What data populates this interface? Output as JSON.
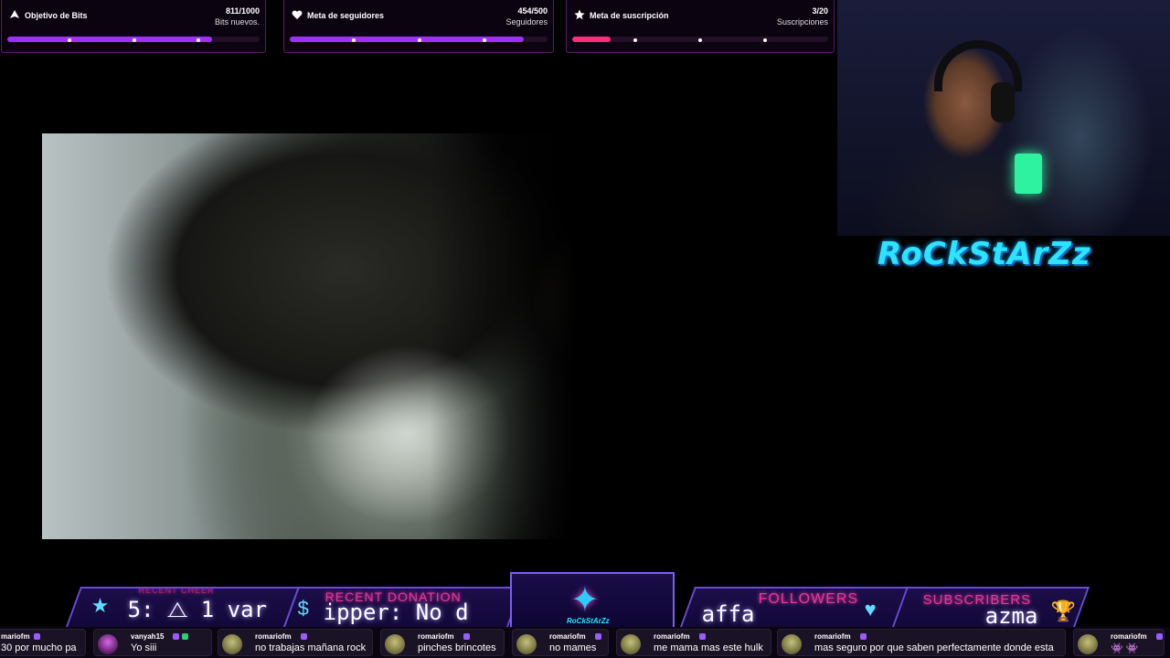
{
  "goals": [
    {
      "id": "bits",
      "icon": "bits-icon",
      "title": "Objetivo de Bits",
      "count": "811/1000",
      "subtitle": "Bits nuevos.",
      "progress": 0.811,
      "color": "#9b30ff"
    },
    {
      "id": "followers",
      "icon": "heart-icon",
      "title": "Meta de seguidores",
      "count": "454/500",
      "subtitle": "Seguidores",
      "progress": 0.908,
      "color": "#9b30ff"
    },
    {
      "id": "subs",
      "icon": "star-icon",
      "title": "Meta de suscripción",
      "count": "3/20",
      "subtitle": "Suscripciones",
      "progress": 0.15,
      "color": "#ff2d7a"
    }
  ],
  "streamer": {
    "name_logo": "RoCkStArZz"
  },
  "alerts": {
    "recent_cheer": {
      "label": "RECENT CHEER",
      "value": "5: ⧍ 1  var"
    },
    "recent_donation": {
      "label": "RECENT DONATION",
      "value": "ipper: No d"
    },
    "center_badge": {
      "text": "RoCkStArZz"
    },
    "followers": {
      "label": "FOLLOWERS",
      "value": "affa"
    },
    "subscribers": {
      "label": "SUBSCRIBERS",
      "value": "azma"
    }
  },
  "chat": [
    {
      "user": "mariofm",
      "text": "30 por mucho pa",
      "avatar": "default"
    },
    {
      "user": "vanyah15",
      "text": "Yo siii",
      "avatar": "violet"
    },
    {
      "user": "romariofm",
      "text": "no trabajas mañana rock",
      "avatar": "default"
    },
    {
      "user": "romariofm",
      "text": "pinches brincotes",
      "avatar": "default"
    },
    {
      "user": "romariofm",
      "text": "no mames",
      "avatar": "default"
    },
    {
      "user": "romariofm",
      "text": "me mama mas este hulk",
      "avatar": "default"
    },
    {
      "user": "romariofm",
      "text": "mas seguro por que saben perfectamente donde esta",
      "avatar": "default"
    },
    {
      "user": "romariofm",
      "text": "👾 👾",
      "avatar": "default"
    }
  ]
}
